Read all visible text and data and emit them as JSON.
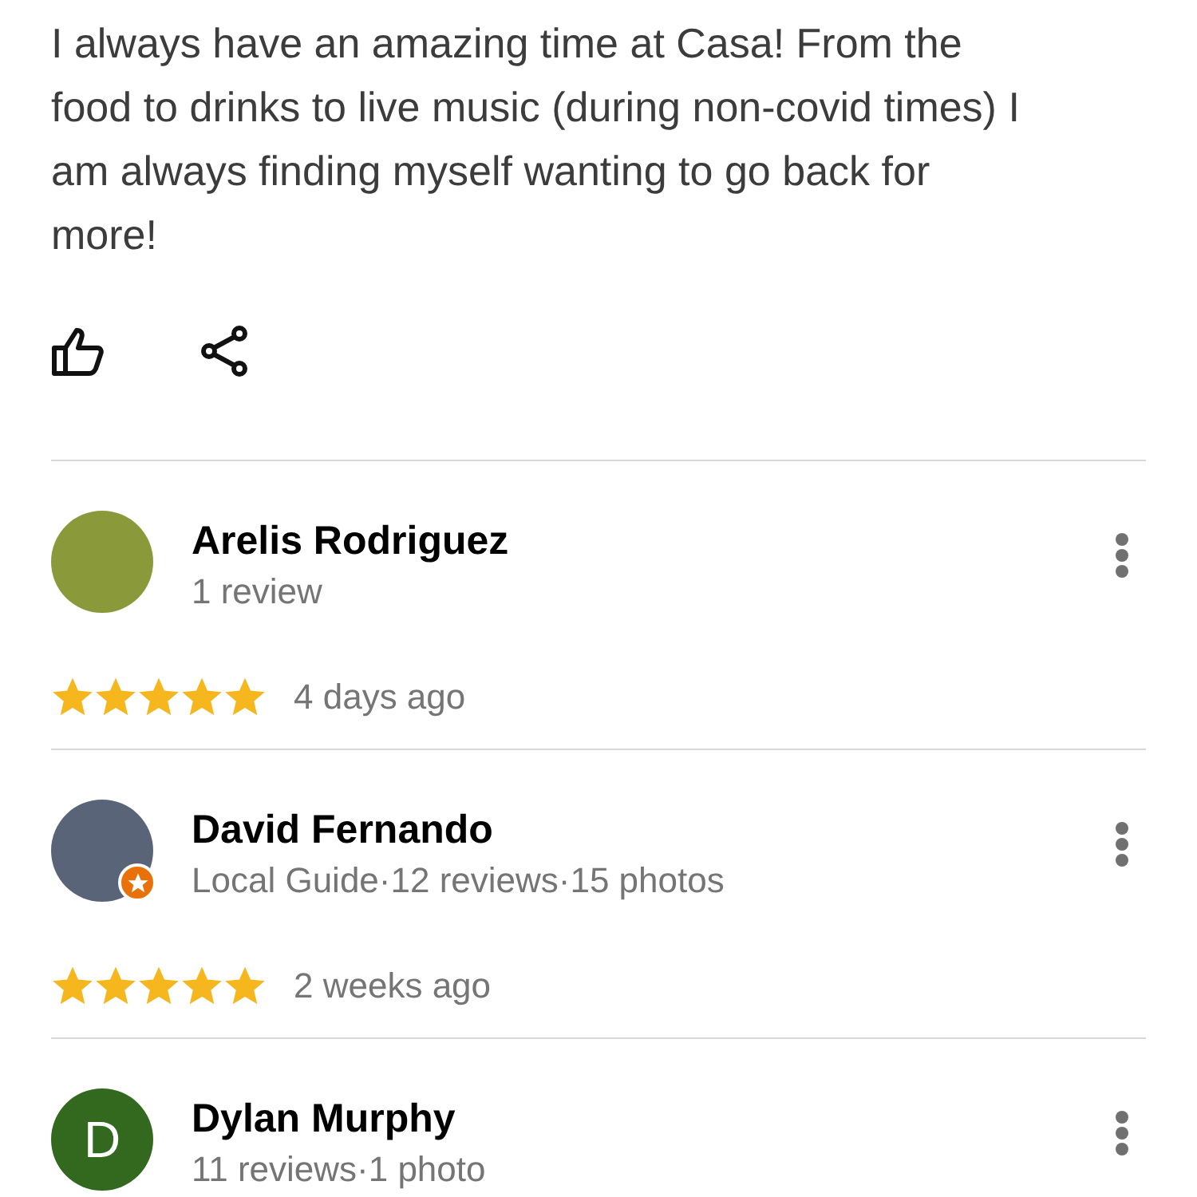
{
  "review_text": "I always have an amazing time at Casa! From the food to drinks to live music (during non-covid times) I am always finding myself wanting to go back for more!",
  "reviews": [
    {
      "kind": "photo",
      "name": "Arelis Rodriguez",
      "subtitle": "1 review",
      "local_guide": false,
      "stars": 5,
      "time": "4 days ago"
    },
    {
      "kind": "photo",
      "name": "David Fernando",
      "subtitle": "Local Guide·12 reviews·15 photos",
      "local_guide": true,
      "stars": 5,
      "time": "2 weeks ago"
    },
    {
      "kind": "letter",
      "letter": "D",
      "name": "Dylan Murphy",
      "subtitle": "11 reviews·1 photo",
      "local_guide": false
    }
  ]
}
